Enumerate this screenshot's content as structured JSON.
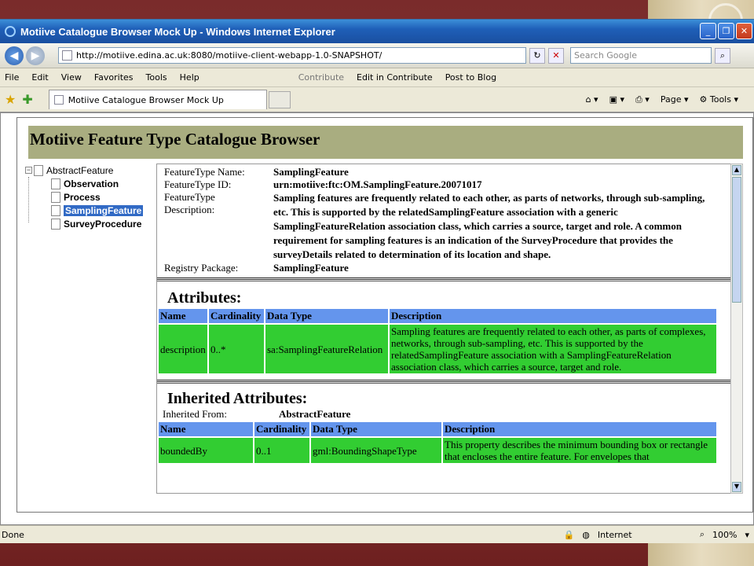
{
  "window": {
    "title": "Motiive Catalogue Browser Mock Up - Windows Internet Explorer"
  },
  "address": {
    "url": "http://motiive.edina.ac.uk:8080/motiive-client-webapp-1.0-SNAPSHOT/",
    "search_placeholder": "Search Google"
  },
  "menu": [
    "File",
    "Edit",
    "View",
    "Favorites",
    "Tools",
    "Help"
  ],
  "contribute": {
    "label": "Contribute",
    "edit": "Edit in Contribute",
    "post": "Post to Blog"
  },
  "tab": {
    "label": "Motiive Catalogue Browser Mock Up"
  },
  "toolbar": {
    "page": "Page",
    "tools": "Tools"
  },
  "status": {
    "text": "Done",
    "zone": "Internet",
    "zoom": "100%"
  },
  "app": {
    "title": "Motiive Feature Type Catalogue Browser"
  },
  "tree": {
    "root": "AbstractFeature",
    "children": [
      "Observation",
      "Process",
      "SamplingFeature",
      "SurveyProcedure"
    ]
  },
  "detail": {
    "name_label": "FeatureType Name:",
    "name": "SamplingFeature",
    "id_label": "FeatureType ID:",
    "id": "urn:motiive:ftc:OM.SamplingFeature.20071017",
    "desc_label1": "FeatureType",
    "desc_label2": "Description:",
    "description": "Sampling features are frequently related to each other, as parts of networks, through sub-sampling, etc. This is supported by the relatedSamplingFeature association with a generic SamplingFeatureRelation association class, which carries a source, target and role. A common requirement for sampling features is an indication of the SurveyProcedure that provides the surveyDetails related to determination of its location and shape.",
    "pkg_label": "Registry Package:",
    "pkg": "SamplingFeature"
  },
  "attributes": {
    "heading": "Attributes:",
    "columns": [
      "Name",
      "Cardinality",
      "Data Type",
      "Description"
    ],
    "rows": [
      [
        "description",
        "0..*",
        "sa:SamplingFeatureRelation",
        "Sampling features are frequently related to each other, as parts of complexes, networks, through sub-sampling, etc. This is supported by the relatedSamplingFeature association with a SamplingFeatureRelation association class, which carries a source, target and role."
      ]
    ]
  },
  "inherited": {
    "heading": "Inherited Attributes:",
    "from_label": "Inherited From:",
    "from": "AbstractFeature",
    "columns": [
      "Name",
      "Cardinality",
      "Data Type",
      "Description"
    ],
    "rows": [
      [
        "boundedBy",
        "0..1",
        "gml:BoundingShapeType",
        "This property describes the minimum bounding box or rectangle that encloses the entire feature. For envelopes that"
      ]
    ]
  }
}
